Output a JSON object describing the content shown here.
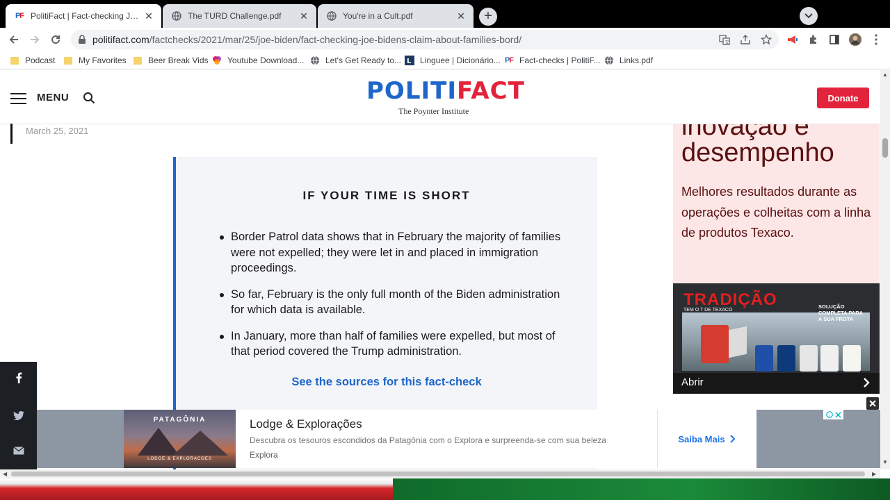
{
  "browser": {
    "tabs": [
      {
        "title": "PolitiFact | Fact-checking Joe Biden's claim about families bord",
        "active": true
      },
      {
        "title": "The TURD Challenge.pdf",
        "active": false
      },
      {
        "title": "You're in a Cult.pdf",
        "active": false
      }
    ],
    "new_tab_label": "+",
    "url_host": "politifact.com",
    "url_path": "/factchecks/2021/mar/25/joe-biden/fact-checking-joe-bidens-claim-about-families-bord/",
    "bookmarks": [
      {
        "label": "Podcast",
        "icon": "folder-icon"
      },
      {
        "label": "My Favorites",
        "icon": "folder-icon"
      },
      {
        "label": "Beer Break Vids",
        "icon": "folder-icon"
      },
      {
        "label": "Youtube Download...",
        "icon": "youtube-download-icon"
      },
      {
        "label": "Let's Get Ready to...",
        "icon": "globe-icon"
      },
      {
        "label": "Linguee | Dicionário...",
        "icon": "linguee-icon"
      },
      {
        "label": "Fact-checks | PolitiF...",
        "icon": "politifact-icon"
      },
      {
        "label": "Links.pdf",
        "icon": "globe-icon"
      }
    ]
  },
  "site": {
    "menu_label": "MENU",
    "logo_left": "POLITI",
    "logo_right": "FACT",
    "logo_sub": "The Poynter Institute",
    "donate_label": "Donate",
    "brand_blue": "#1e66c9",
    "brand_red": "#e3233b"
  },
  "article": {
    "date": "March 25, 2021",
    "tldr_title": "IF YOUR TIME IS SHORT",
    "bullets": [
      "Border Patrol data shows that in February the majority of families were not expelled; they were let in and placed in immigration proceedings.",
      "So far, February is the only full month of the Biden administration for which data is available.",
      "In January, more than half of families were expelled, but most of that period covered the Trump administration."
    ],
    "sources_link": "See the sources for this fact-check"
  },
  "side_ad": {
    "headline_1": "inovação e",
    "headline_2": "desempenho",
    "body": "Melhores resultados durante as operações e colheitas com a linha de produtos Texaco.",
    "image_title": "TRADIÇÃO",
    "image_tagline": "TEM O T DE TEXACO",
    "image_solution": "SOLUÇÃO COMPLETA PARA A SUA FROTA",
    "open_label": "Abrir"
  },
  "bottom_ad": {
    "thumb_title": "PATAGÔNIA",
    "thumb_sub": "LODGE & EXPLORACOES",
    "title": "Lodge & Explorações",
    "description": "Descubra os tesouros escondidos da Patagônia com o Explora e surpreenda-se com sua beleza",
    "brand": "Explora",
    "cta": "Saiba Mais"
  }
}
